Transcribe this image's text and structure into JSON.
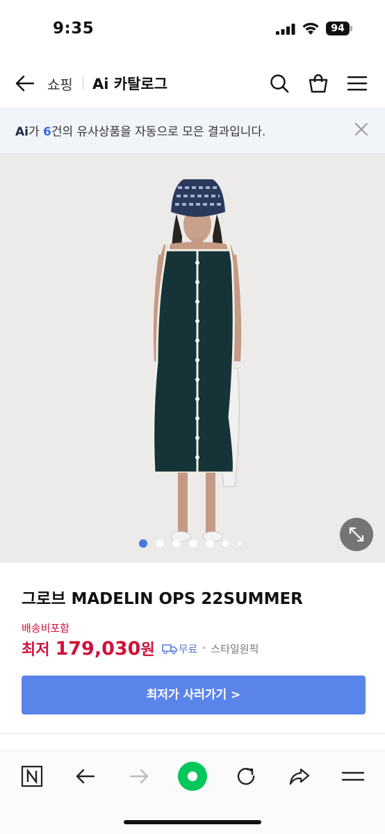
{
  "status_bar": {
    "time": "9:35",
    "battery": "94"
  },
  "header": {
    "breadcrumb": "쇼핑",
    "title": "Ai 카탈로그",
    "icons": [
      "back-arrow-icon",
      "search-icon",
      "shopping-bag-icon",
      "hamburger-menu-icon"
    ]
  },
  "notice": {
    "ai_prefix": "Ai",
    "part1": "가 ",
    "count": "6",
    "part2": "건의 유사상품을 자동으로 모은 결과입니다.",
    "close_icon": "close-icon"
  },
  "gallery": {
    "total_images": 6,
    "active_index": 1,
    "expand_icon": "expand-icon"
  },
  "product": {
    "name": "그로브 MADELIN OPS 22SUMMER",
    "shipping_note": "배송비포함",
    "price_label": "최저",
    "price": "179,030",
    "price_unit": "원",
    "delivery": "무료",
    "separator": "•",
    "seller": "스타일원픽",
    "buy_button": "최저가 사러가기 >"
  },
  "colors": {
    "accent": "#5b84ea",
    "price_red": "#d0103a",
    "notice_bg": "#f1f4f9",
    "green": "#03c75a"
  },
  "bottom_bar": {
    "icons": [
      "naver-n-icon",
      "back-icon",
      "forward-icon",
      "green-dot-home-icon",
      "reload-icon",
      "share-icon",
      "menu-icon"
    ]
  }
}
